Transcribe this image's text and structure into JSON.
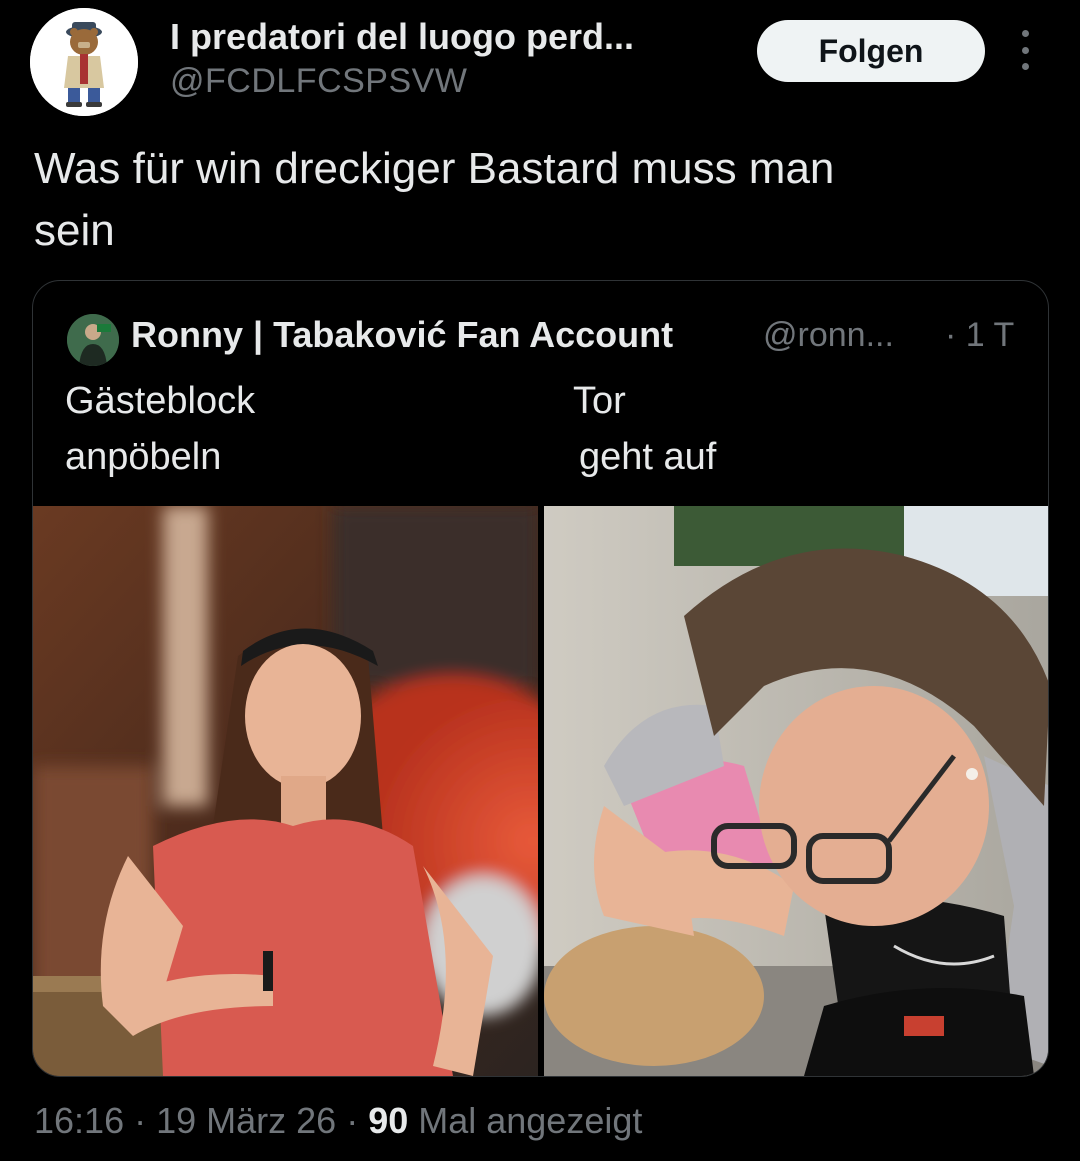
{
  "header": {
    "display_name": "I predatori del luogo perd...",
    "handle": "@FCDLFCSPSVW",
    "follow_label": "Folgen"
  },
  "tweet": {
    "text_line1": "Was für win dreckiger Bastard muss man",
    "text_line2": "sein"
  },
  "quote": {
    "author_name": "Ronny | Tabaković Fan Account",
    "author_handle": "@ronn...",
    "time": "· 1 T",
    "left_caption_line1": "Gästeblock",
    "left_caption_line2": "anpöbeln",
    "right_caption_line1": "Tor",
    "right_caption_line2": "geht auf"
  },
  "footer": {
    "time": "16:16",
    "sep1": " · ",
    "date": "19 März 26",
    "sep2": " · ",
    "views_count": "90",
    "views_label": " Mal angezeigt"
  },
  "colors": {
    "background": "#000000",
    "primary_text": "#e7e9ea",
    "secondary_text": "#71767b",
    "follow_button_bg": "#eff3f4",
    "card_border": "#2f3336"
  },
  "icons": [
    "more-vertical-icon"
  ]
}
